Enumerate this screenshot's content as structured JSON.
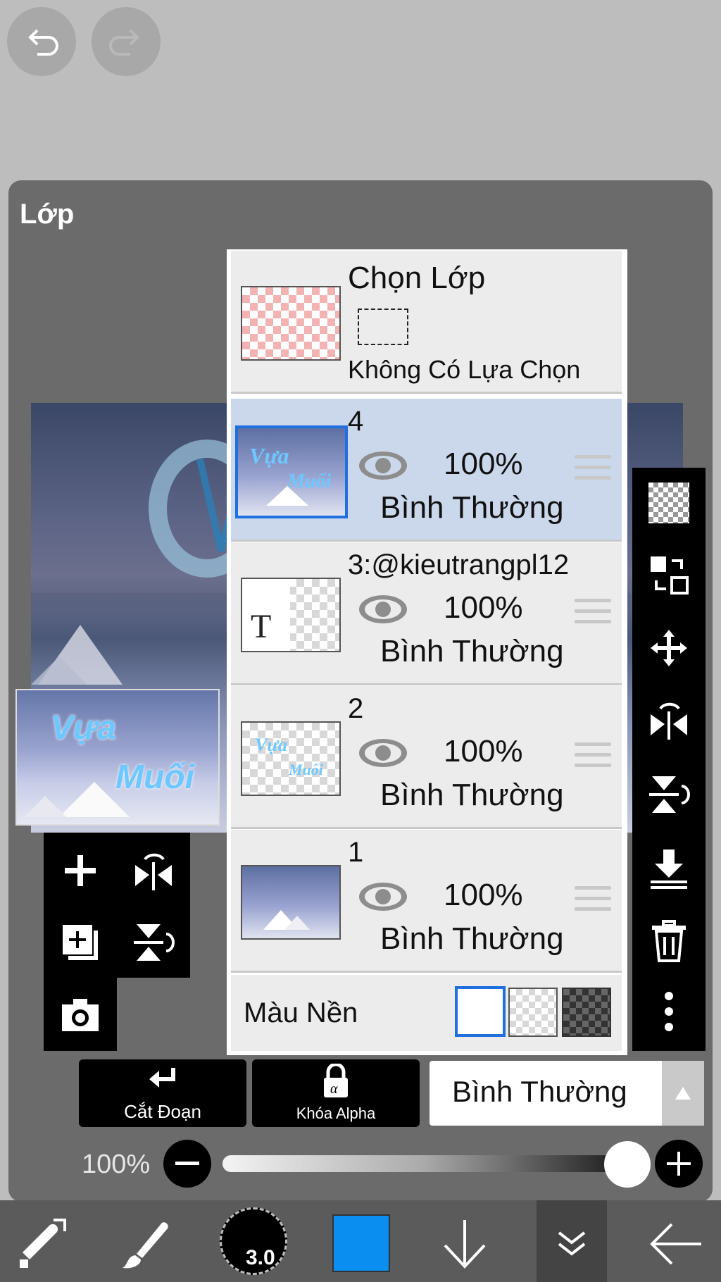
{
  "top_controls": {
    "undo": "undo-icon",
    "redo": "redo-icon"
  },
  "panel": {
    "title": "Lớp"
  },
  "preview": {
    "thumbnail_text": [
      "Vựa",
      "Muối"
    ]
  },
  "selection_row": {
    "title": "Chọn Lớp",
    "subtitle": "Không Có Lựa Chọn"
  },
  "layers": [
    {
      "name": "4",
      "opacity": "100%",
      "blend": "Bình Thường"
    },
    {
      "name": "3:@kieutrangpl12",
      "opacity": "100%",
      "blend": "Bình Thường"
    },
    {
      "name": "2",
      "opacity": "100%",
      "blend": "Bình Thường"
    },
    {
      "name": "1",
      "opacity": "100%",
      "blend": "Bình Thường"
    }
  ],
  "background_row": {
    "label": "Màu Nền"
  },
  "bottom_buttons": {
    "clip": "Cắt Đoạn",
    "alpha_lock": "Khóa Alpha",
    "blend_mode": "Bình Thường"
  },
  "opacity_slider": {
    "label": "100%",
    "value": 1.0
  },
  "brush_size": "3.0",
  "colors": {
    "accent": "#1f6fe0",
    "current_color": "#0a8ef0",
    "panel": "#6b6b6b"
  }
}
